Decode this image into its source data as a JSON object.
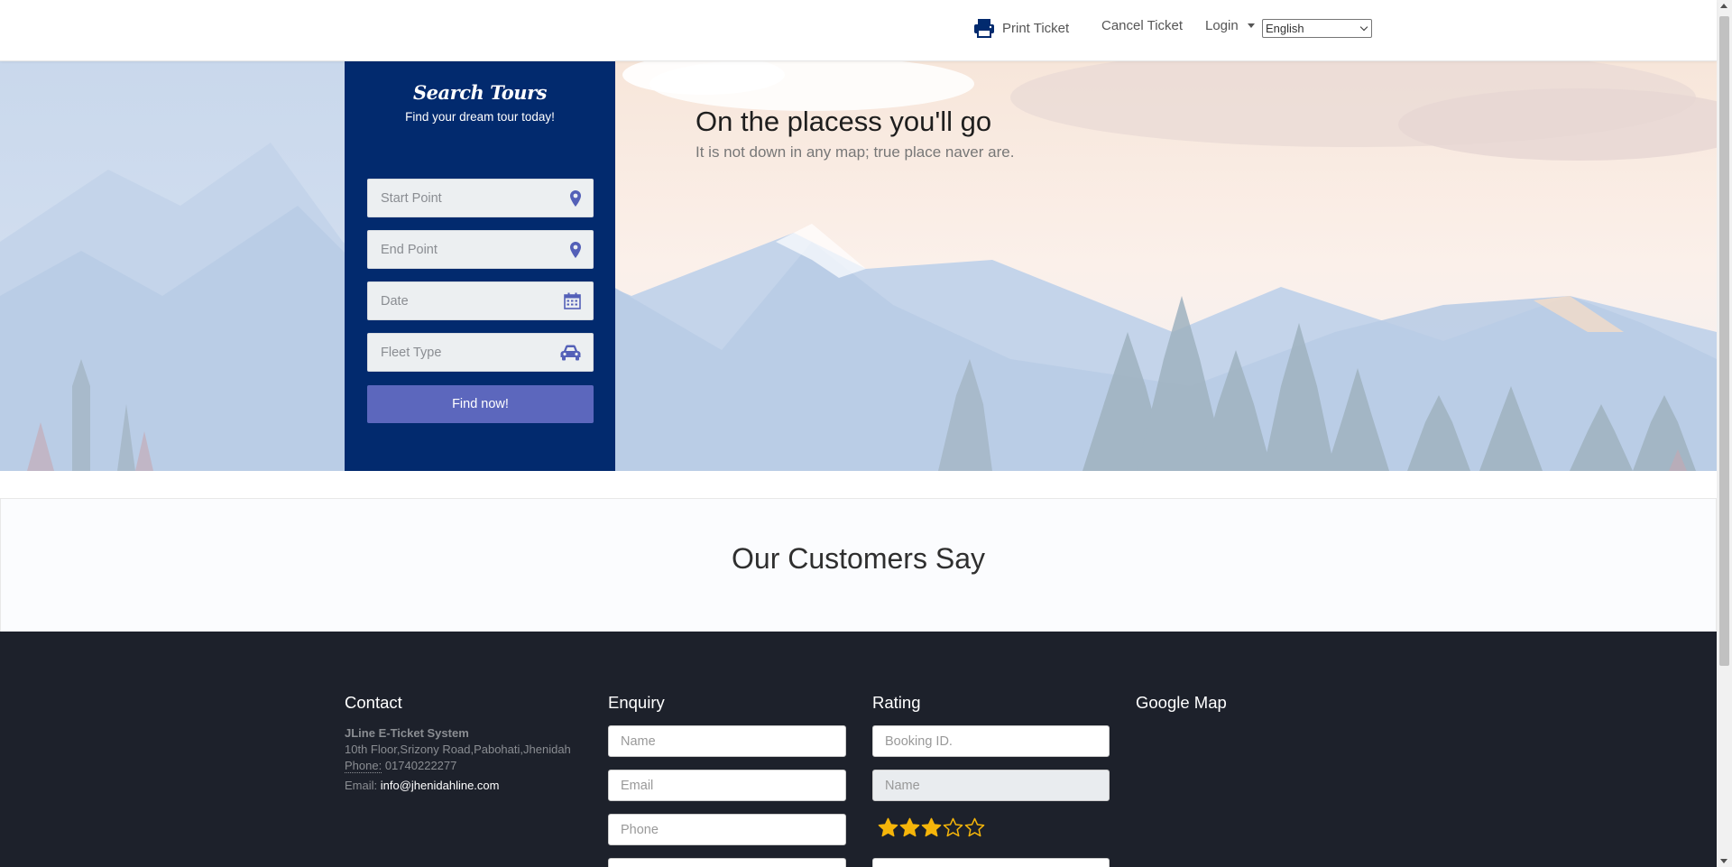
{
  "nav": {
    "print_ticket": "Print Ticket",
    "cancel_ticket": "Cancel Ticket",
    "login": "Login",
    "language": "English"
  },
  "search": {
    "title": "Search Tours",
    "subtitle": "Find your dream tour today!",
    "start_point_placeholder": "Start Point",
    "end_point_placeholder": "End Point",
    "date_placeholder": "Date",
    "fleet_type_placeholder": "Fleet Type",
    "find_button": "Find now!"
  },
  "hero": {
    "heading": "On the placess you'll go",
    "subheading": "It is not down in any map; true place naver are."
  },
  "customers": {
    "heading": "Our Customers Say"
  },
  "footer": {
    "contact": {
      "title": "Contact",
      "company": "JLine E-Ticket System",
      "address": "10th Floor,Srizony Road,Pabohati,Jhenidah",
      "phone_label": "Phone:",
      "phone": "01740222277",
      "email_label": "Email:",
      "email": "info@jhenidahline.com"
    },
    "enquiry": {
      "title": "Enquiry",
      "name_placeholder": "Name",
      "email_placeholder": "Email",
      "phone_placeholder": "Phone"
    },
    "rating": {
      "title": "Rating",
      "booking_placeholder": "Booking ID.",
      "name_placeholder": "Name",
      "stars_filled": 3,
      "stars_total": 5
    },
    "map": {
      "title": "Google Map"
    }
  },
  "colors": {
    "panel_blue": "#022a6e",
    "button_indigo": "#5c67bd",
    "icon_indigo": "#5460b8",
    "footer_bg": "#1d212b",
    "star_gold": "#f5b50a"
  }
}
